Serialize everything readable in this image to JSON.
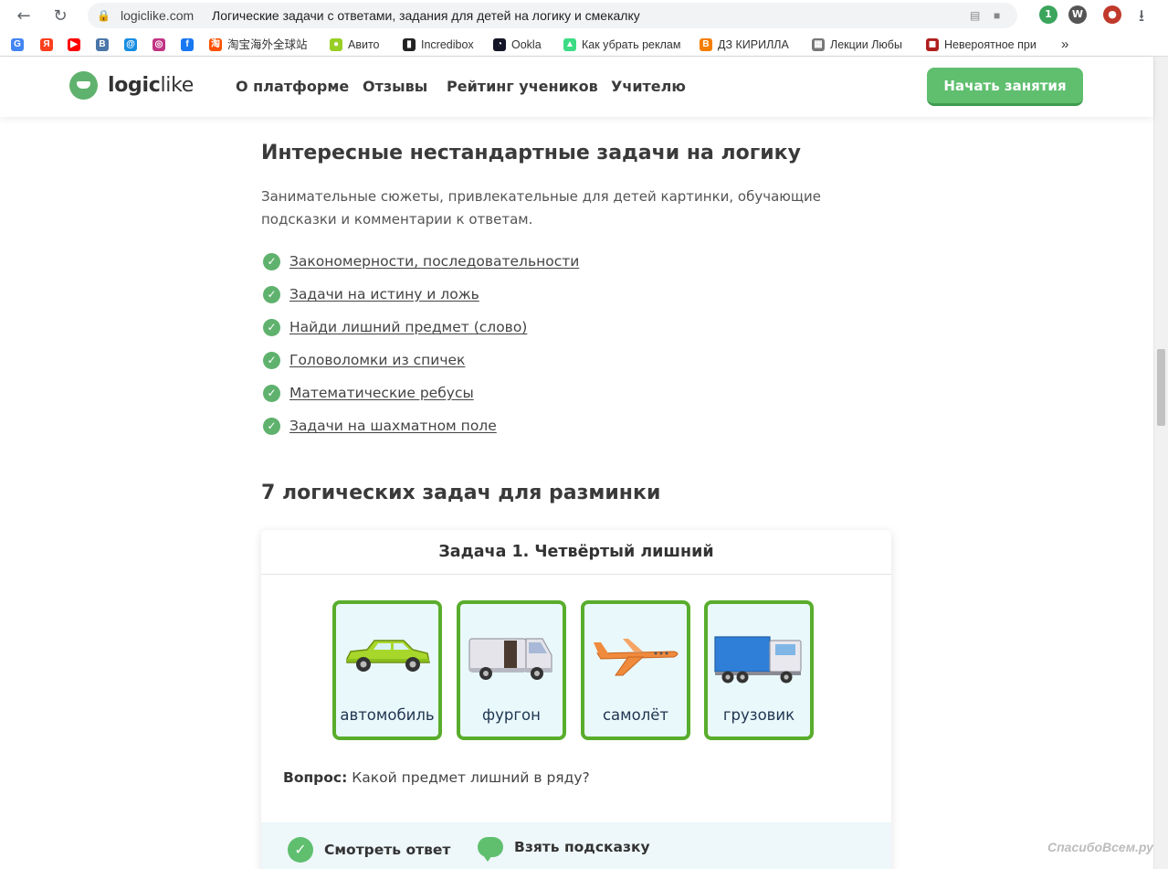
{
  "browser": {
    "url_host": "logiclike.com",
    "page_title": "Логические задачи с ответами, задания для детей на логику и смекалку",
    "bookmarks": [
      {
        "label": "",
        "icon": "google-icon",
        "color": "#4285f4"
      },
      {
        "label": "",
        "icon": "yandex-icon",
        "color": "#fc3f1d"
      },
      {
        "label": "",
        "icon": "youtube-icon",
        "color": "#ff0000"
      },
      {
        "label": "",
        "icon": "vk-icon",
        "color": "#4a76a8"
      },
      {
        "label": "",
        "icon": "mail-icon",
        "color": "#168de2"
      },
      {
        "label": "",
        "icon": "instagram-icon",
        "color": "#c13584"
      },
      {
        "label": "",
        "icon": "facebook-icon",
        "color": "#1877f2"
      },
      {
        "label": "淘宝海外全球站",
        "icon": "taobao-icon",
        "color": "#ff5000"
      },
      {
        "label": "Авито",
        "icon": "avito-icon",
        "color": "#97cf26"
      },
      {
        "label": "Incredibox",
        "icon": "incredibox-icon",
        "color": "#222222"
      },
      {
        "label": "Ookla",
        "icon": "ookla-icon",
        "color": "#141526"
      },
      {
        "label": "Как убрать реклам",
        "icon": "android-icon",
        "color": "#3ddc84"
      },
      {
        "label": "ДЗ КИРИЛЛА",
        "icon": "blogger-icon",
        "color": "#f57d00"
      },
      {
        "label": "Лекции Любы",
        "icon": "folder-icon",
        "color": "#777777"
      },
      {
        "label": "Невероятное при",
        "icon": "site-icon",
        "color": "#b01e1e"
      }
    ],
    "more_label": "»"
  },
  "header": {
    "logo_bold": "logic",
    "logo_light": "like",
    "menu": [
      "О платформе",
      "Отзывы",
      "Рейтинг учеников",
      "Учителю"
    ],
    "cta_label": "Начать занятия"
  },
  "section1": {
    "title": "Интересные нестандартные задачи на логику",
    "intro_line1": "Занимательные сюжеты, привлекательные для детей картинки, обучающие",
    "intro_line2": "подсказки и комментарии к ответам.",
    "links": [
      "Закономерности, последовательности",
      "Задачи на истину и ложь",
      "Найди лишний предмет (слово)",
      "Головоломки из спичек",
      "Математические ребусы",
      "Задачи на шахматном поле"
    ]
  },
  "section2": {
    "title": "7 логических задач для разминки"
  },
  "task": {
    "title": "Задача 1. Четвёртый лишний",
    "items": [
      {
        "label": "автомобиль",
        "icon": "car-icon"
      },
      {
        "label": "фургон",
        "icon": "van-icon"
      },
      {
        "label": "самолёт",
        "icon": "airplane-icon"
      },
      {
        "label": "грузовик",
        "icon": "truck-icon"
      }
    ],
    "question_label": "Вопрос:",
    "question_text": "Какой предмет лишний в ряду?",
    "show_answer": "Смотреть ответ",
    "take_hint": "Взять подсказку"
  },
  "watermark": "СпасибоВсем.ру",
  "colors": {
    "brand_green": "#5fb26d",
    "cta_green": "#5fbf6f",
    "tile_border": "#59ad2c",
    "tile_bg": "#e9f8fb"
  }
}
